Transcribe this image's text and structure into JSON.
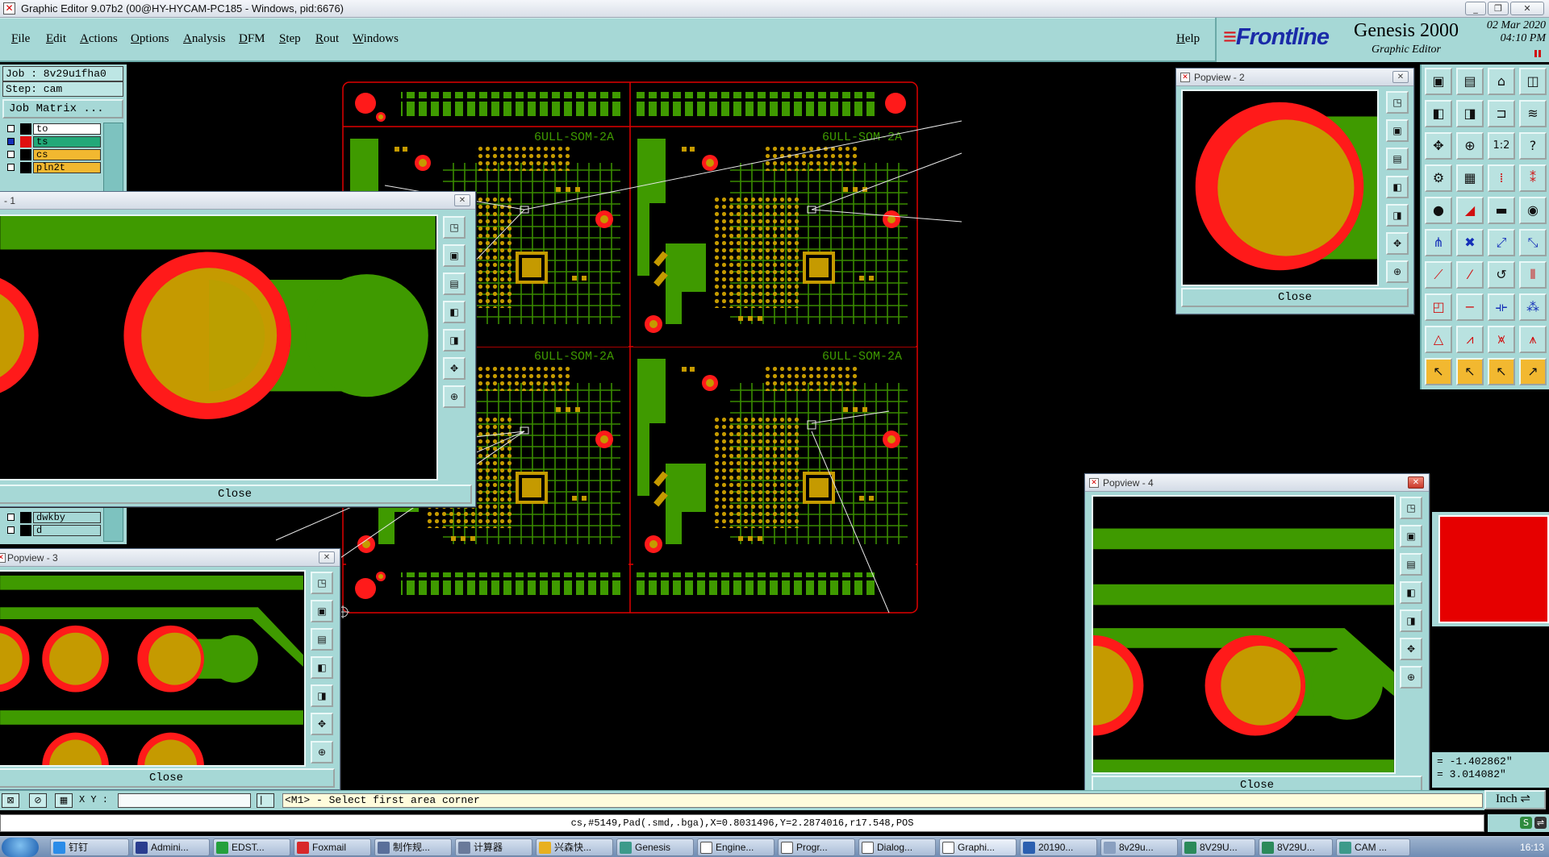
{
  "window": {
    "title": "Graphic Editor 9.07b2 (00@HY-HYCAM-PC185 - Windows, pid:6676)",
    "controls": [
      "_",
      "❐",
      "✕"
    ]
  },
  "menu": {
    "items": [
      "File",
      "Edit",
      "Actions",
      "Options",
      "Analysis",
      "DFM",
      "Step",
      "Rout",
      "Windows"
    ],
    "help": "Help"
  },
  "brand": {
    "logo": "Frontline",
    "product": "Genesis 2000",
    "subtitle": "Graphic Editor",
    "date": "02 Mar 2020",
    "time": "04:10 PM"
  },
  "job_panel": {
    "job": "Job : 8v29u1fha0",
    "step": "Step: cam",
    "job_matrix_button": "Job Matrix ...",
    "layers": [
      {
        "name": "to",
        "color": "#ffffff",
        "swatch": "#000000"
      },
      {
        "name": "ts",
        "color": "#22a878",
        "swatch": "#e01010"
      },
      {
        "name": "cs",
        "color": "#f2b830",
        "swatch": "#000000"
      },
      {
        "name": "pln2t",
        "color": "#f2b830",
        "swatch": "#000000"
      }
    ],
    "layers_lower": [
      {
        "name": "dwkby",
        "color": "#a6d8d6",
        "swatch": "#000000"
      },
      {
        "name": "d",
        "color": "#a6d8d6",
        "swatch": "#000000"
      }
    ]
  },
  "board": {
    "module_label": "6ULL-SOM-2A"
  },
  "popviews": {
    "p1": {
      "title": "- 1",
      "close": "Close"
    },
    "p2": {
      "title": "Popview - 2",
      "close": "Close"
    },
    "p3": {
      "title": "Popview - 3",
      "close": "Close"
    },
    "p4": {
      "title": "Popview - 4",
      "close": "Close"
    }
  },
  "toolbox": {
    "icons": [
      "save-icon",
      "open-icon",
      "home-icon",
      "window-icon",
      "zoom-in-icon",
      "zoom-out-icon",
      "fit-icon",
      "scale-1-2-icon",
      "zoom-fit-icon",
      "zoom-home-icon",
      "ratio-1-2-icon",
      "help-icon"
    ],
    "ratio_label": "1:2"
  },
  "coords": {
    "x": "= -1.402862\"",
    "y": "= 3.014082\""
  },
  "units": "Inch",
  "prompt": {
    "xy_label": "X Y :",
    "message": "<M1> - Select first area corner"
  },
  "status": "cs,#5149,Pad(.smd,.bga),X=0.8031496,Y=2.2874016,r17.548,POS",
  "taskbar": {
    "items": [
      "钉钉",
      "Admini...",
      "EDST...",
      "Foxmail",
      "制作规...",
      "计算器",
      "兴森快...",
      "Genesis",
      "Engine...",
      "Progr...",
      "Dialog...",
      "Graphi...",
      "20190...",
      "8v29u...",
      "8V29U...",
      "8V29U...",
      "CAM ..."
    ],
    "clock": "16:13"
  },
  "colors": {
    "panel": "#a6d8d6",
    "pad": "#c59a00",
    "solder_mask": "#ff1a1a",
    "copper": "#3f9a00",
    "outline": "#e00000"
  }
}
